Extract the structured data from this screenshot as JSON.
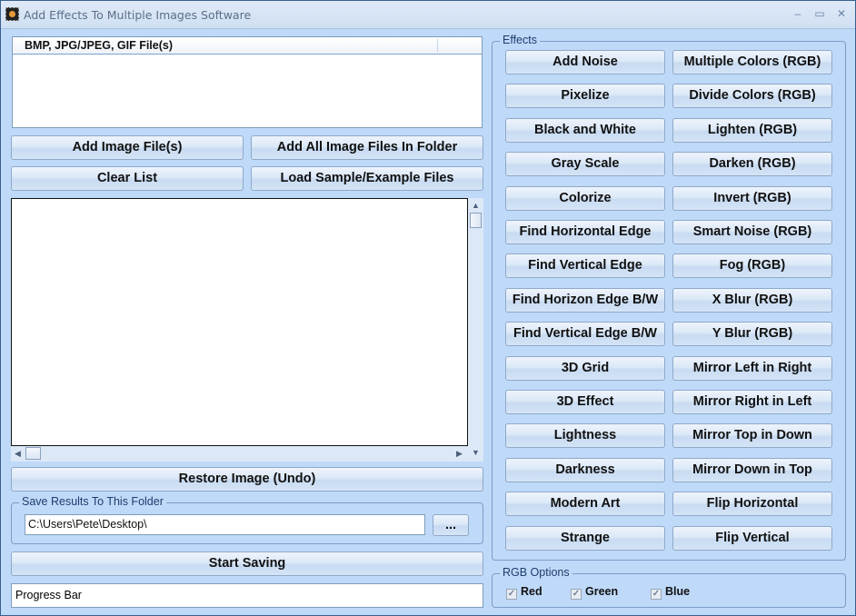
{
  "window": {
    "title": "Add Effects To Multiple Images Software",
    "controls": {
      "minimize": "–",
      "maximize": "▭",
      "close": "✕"
    },
    "icon": "app-icon"
  },
  "file_list": {
    "column_header": "BMP, JPG/JPEG, GIF File(s)",
    "items": []
  },
  "file_buttons": {
    "add_files": "Add Image File(s)",
    "add_folder": "Add All Image Files In Folder",
    "clear_list": "Clear List",
    "load_samples": "Load Sample/Example Files"
  },
  "preview": {
    "scroll_up": "▲",
    "scroll_down": "▼",
    "scroll_left": "◀",
    "scroll_right": "▶"
  },
  "restore_button": "Restore Image (Undo)",
  "save_group": {
    "label": "Save Results To This Folder",
    "folder_value": "C:\\Users\\Pete\\Desktop\\",
    "browse_label": "..."
  },
  "start_saving": "Start Saving",
  "progress_bar": {
    "label": "Progress Bar"
  },
  "effects": {
    "label": "Effects",
    "left": [
      "Add Noise",
      "Pixelize",
      "Black and White",
      "Gray Scale",
      "Colorize",
      "Find Horizontal Edge",
      "Find Vertical Edge",
      "Find Horizon Edge B/W",
      "Find Vertical Edge B/W",
      "3D Grid",
      "3D Effect",
      "Lightness",
      "Darkness",
      "Modern Art",
      "Strange"
    ],
    "right": [
      "Multiple Colors (RGB)",
      "Divide Colors (RGB)",
      "Lighten (RGB)",
      "Darken (RGB)",
      "Invert (RGB)",
      "Smart Noise (RGB)",
      "Fog (RGB)",
      "X Blur (RGB)",
      "Y Blur (RGB)",
      "Mirror Left in Right",
      "Mirror Right in Left",
      "Mirror Top in Down",
      "Mirror Down in Top",
      "Flip Horizontal",
      "Flip Vertical"
    ]
  },
  "rgb_options": {
    "label": "RGB Options",
    "check_glyph": "✓",
    "red": {
      "label": "Red",
      "checked": true
    },
    "green": {
      "label": "Green",
      "checked": true
    },
    "blue": {
      "label": "Blue",
      "checked": true
    }
  }
}
